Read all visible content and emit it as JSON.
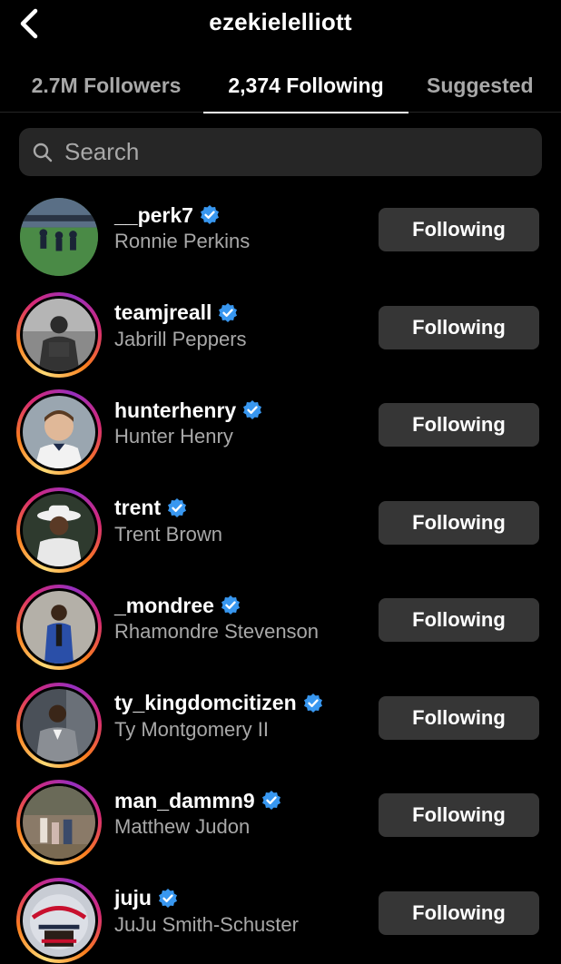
{
  "header": {
    "title": "ezekielelliott"
  },
  "tabs": [
    {
      "label": "2.7M Followers"
    },
    {
      "label": "2,374 Following"
    },
    {
      "label": "Suggested"
    }
  ],
  "search": {
    "placeholder": "Search"
  },
  "colors": {
    "background": "#000000",
    "button": "#363636",
    "verified": "#3897f0",
    "secondary_text": "#a8a8a8"
  },
  "users": [
    {
      "username": "__perk7",
      "full_name": "Ronnie Perkins",
      "button": "Following"
    },
    {
      "username": "teamjreall",
      "full_name": "Jabrill Peppers",
      "button": "Following"
    },
    {
      "username": "hunterhenry",
      "full_name": "Hunter Henry",
      "button": "Following"
    },
    {
      "username": "trent",
      "full_name": "Trent Brown",
      "button": "Following"
    },
    {
      "username": "_mondree",
      "full_name": "Rhamondre Stevenson",
      "button": "Following"
    },
    {
      "username": "ty_kingdomcitizen",
      "full_name": "Ty Montgomery II",
      "button": "Following"
    },
    {
      "username": "man_dammn9",
      "full_name": "Matthew Judon",
      "button": "Following"
    },
    {
      "username": "juju",
      "full_name": "JuJu Smith-Schuster",
      "button": "Following"
    }
  ]
}
